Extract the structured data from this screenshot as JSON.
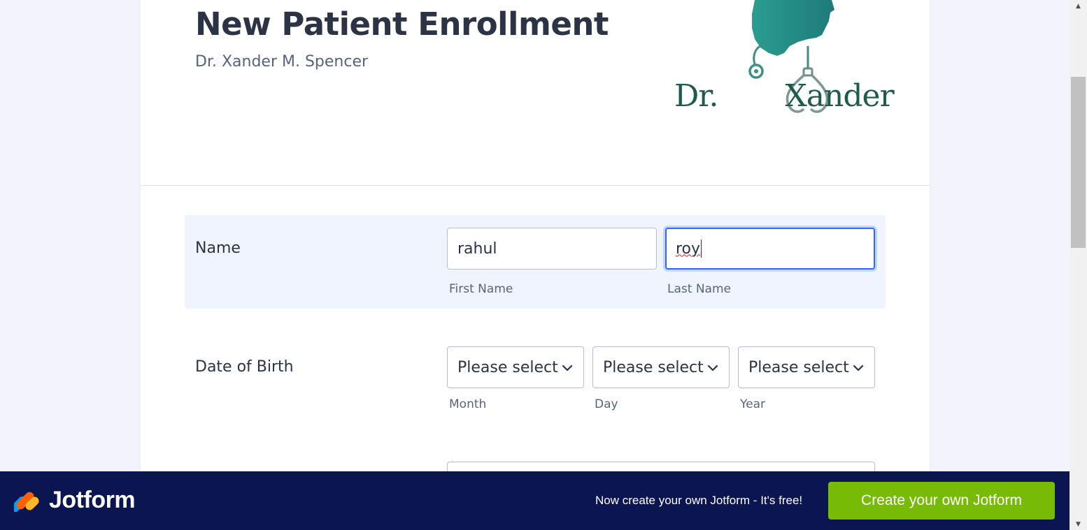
{
  "form": {
    "title": "New Patient Enrollment",
    "subtitle": "Dr. Xander M. Spencer",
    "logo_text": "Dr. Xander"
  },
  "name_field": {
    "label": "Name",
    "first_value": "rahul",
    "last_value": "roy",
    "first_sublabel": "First Name",
    "last_sublabel": "Last Name"
  },
  "dob_field": {
    "label": "Date of Birth",
    "month_value": "Please select",
    "day_value": "Please select",
    "year_value": "Please select",
    "month_sublabel": "Month",
    "day_sublabel": "Day",
    "year_sublabel": "Year"
  },
  "footer": {
    "brand": "Jotform",
    "promo": "Now create your own Jotform - It's free!",
    "cta": "Create your own Jotform"
  },
  "colors": {
    "accent": "#2e69ff",
    "cta_green": "#78bb07",
    "footer_navy": "#0a1551",
    "logo_teal": "#2a8a85"
  },
  "icons": [
    "jotform-logo-icon",
    "chevron-down-icon",
    "scroll-up-icon",
    "scroll-down-icon"
  ]
}
